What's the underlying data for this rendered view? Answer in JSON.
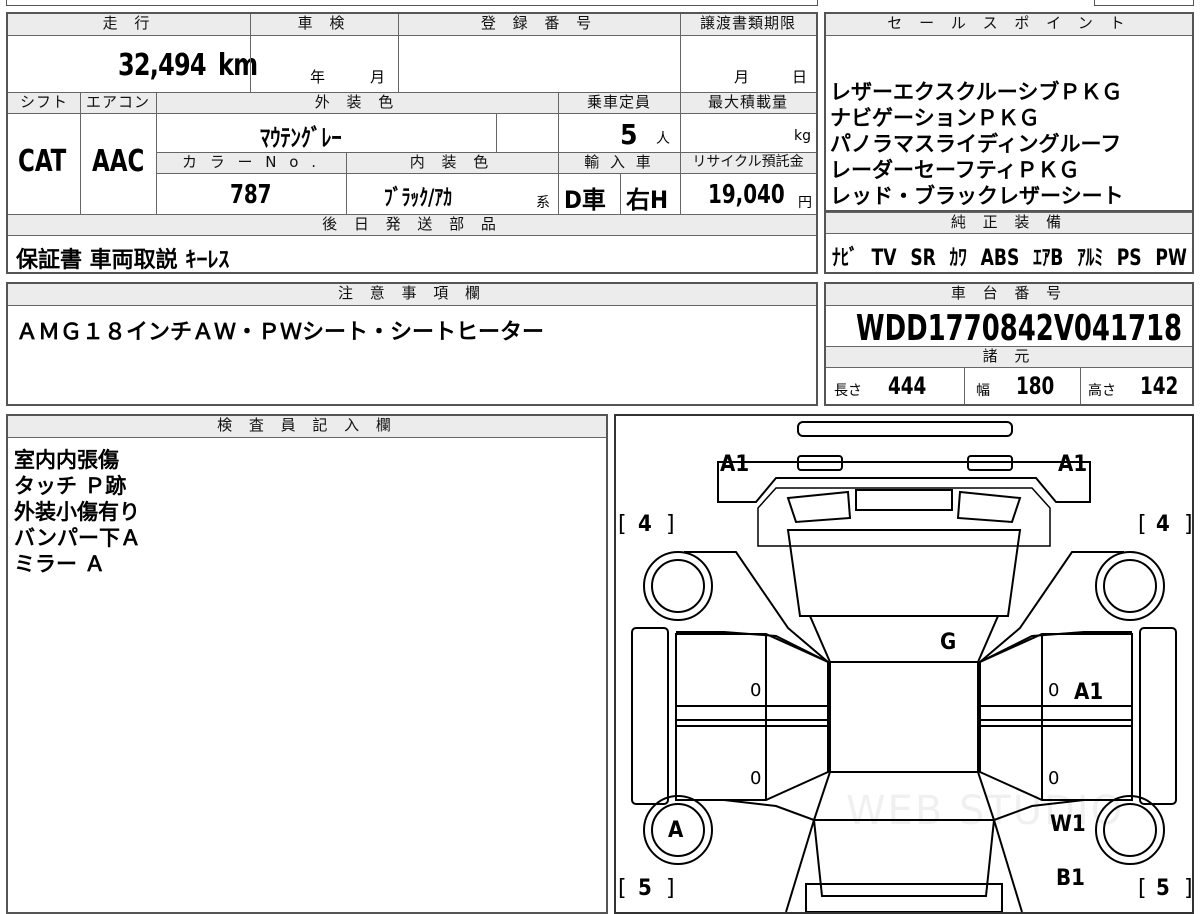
{
  "top_table": {
    "headers": {
      "mileage": "走 行",
      "inspection": "車 検",
      "registration": "登 録 番 号",
      "transfer": "譲渡書類期限",
      "shift": "シフト",
      "aircon": "エアコン",
      "exterior_color": "外 装 色",
      "capacity": "乗車定員",
      "max_load": "最大積載量",
      "color_no": "カ ラ ー N o .",
      "interior_color": "内 装 色",
      "import": "輸 入 車",
      "recycle": "リサイクル預託金",
      "later_parts": "後 日 発 送 部 品"
    },
    "mileage_value": "32,494",
    "mileage_unit": "km",
    "inspection_year": "年",
    "inspection_month": "月",
    "transfer_month": "月",
    "transfer_day": "日",
    "shift_value": "CAT",
    "aircon_value": "AAC",
    "exterior_color_value": "ﾏｳﾃﾝｸﾞﾚｰ",
    "capacity_value": "5",
    "capacity_unit": "人",
    "max_load_unit": "kg",
    "color_no_value": "787",
    "interior_color_value": "ﾌﾞﾗｯｸ/ｱｶ",
    "interior_color_suffix": "系",
    "import_type": "D車",
    "handle": "右H",
    "recycle_value": "19,040",
    "recycle_unit": "円",
    "later_parts_value": "保証書 車両取説 ｷｰﾚｽ"
  },
  "sales_points": {
    "header": "セ ー ル ス ポ イ ン ト",
    "items": [
      "レザーエクスクルーシブＰＫＧ",
      "ナビゲーションＰＫＧ",
      "パノラマスライディングルーフ",
      "レーダーセーフティＰＫＧ",
      "レッド・ブラックレザーシート"
    ]
  },
  "equipment": {
    "header": "純 正 装 備",
    "items": [
      "ﾅﾋﾞ",
      "TV",
      "SR",
      "ｶﾜ",
      "ABS",
      "ｴｱB",
      "ｱﾙﾐ",
      "PS",
      "PW"
    ]
  },
  "notes": {
    "header": "注 意 事 項 欄",
    "text": "ＡＭＧ１８インチＡＷ・ＰＷシート・シートヒーター"
  },
  "chassis": {
    "header": "車 台 番 号",
    "number": "WDD1770842V041718"
  },
  "specs": {
    "header": "諸 元",
    "length_label": "長さ",
    "length_value": "444",
    "width_label": "幅",
    "width_value": "180",
    "height_label": "高さ",
    "height_value": "142"
  },
  "inspector": {
    "header": "検 査 員 記 入 欄",
    "lines": [
      "室内内張傷",
      "タッチ Ｐ跡",
      "外装小傷有り",
      "バンパー下Ａ",
      "ミラー Ａ"
    ]
  },
  "diagram": {
    "marks": {
      "front_left": "A1",
      "front_right": "A1",
      "tire_fl_open": "[",
      "tire_fl": "4",
      "tire_fl_close": "]",
      "tire_fr_open": "[",
      "tire_fr": "4",
      "tire_fr_close": "]",
      "roof": "G",
      "door_rf": "A1",
      "door_rf_zero": "0",
      "door_lf_zero": "0",
      "door_lr_zero": "0",
      "door_rr_zero": "0",
      "wheel_rl": "A",
      "wheel_rr": "W1",
      "rear_right": "B1",
      "tire_rl_open": "[",
      "tire_rl": "5",
      "tire_rl_close": "]",
      "tire_rr_open": "[",
      "tire_rr": "5",
      "tire_rr_close": "]"
    },
    "watermark": "WEB STUDIO"
  }
}
